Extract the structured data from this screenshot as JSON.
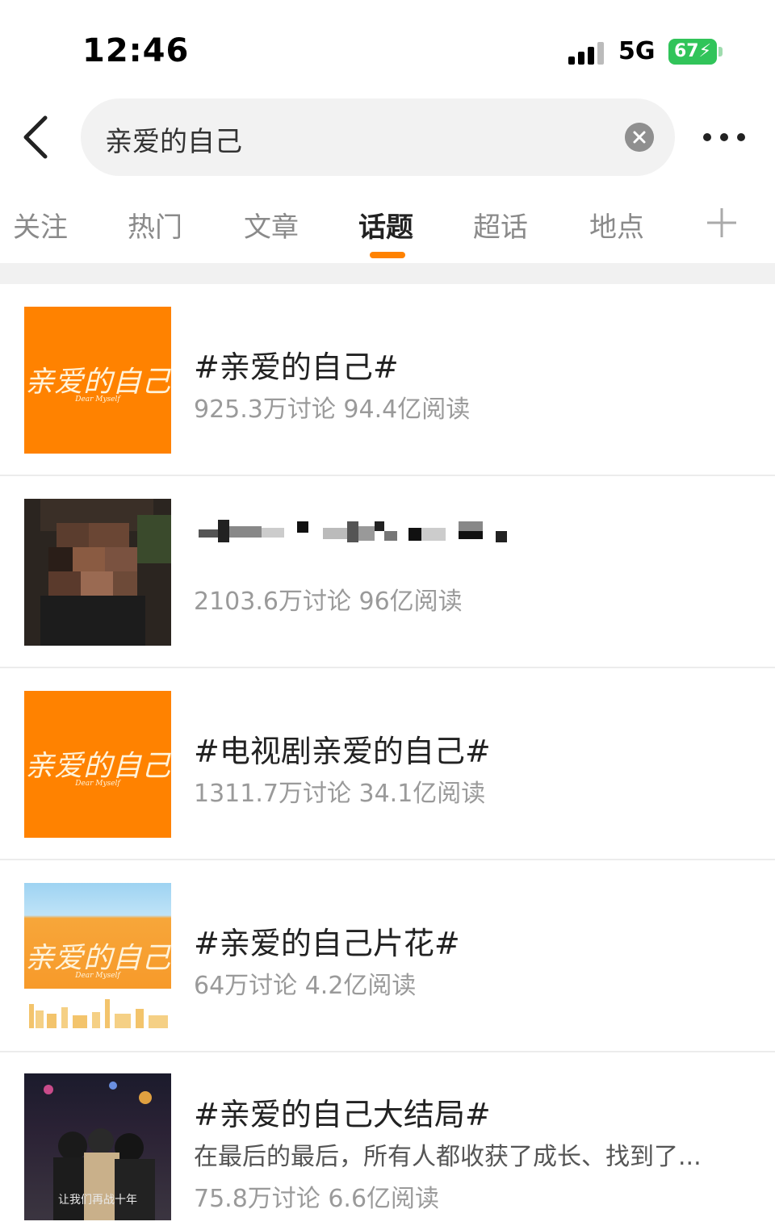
{
  "status": {
    "time": "12:46",
    "network": "5G",
    "battery": "67"
  },
  "search": {
    "query": "亲爱的自己"
  },
  "tabs": [
    {
      "label": "关注"
    },
    {
      "label": "热门"
    },
    {
      "label": "文章"
    },
    {
      "label": "话题",
      "active": true
    },
    {
      "label": "超话"
    },
    {
      "label": "地点"
    }
  ],
  "topics": [
    {
      "logo": "亲爱的自己",
      "logo_sub": "Dear Myself",
      "title": "#亲爱的自己#",
      "stats": "925.3万讨论 94.4亿阅读"
    },
    {
      "title": "",
      "stats": "2103.6万讨论 96亿阅读"
    },
    {
      "logo": "亲爱的自己",
      "logo_sub": "Dear Myself",
      "title": "#电视剧亲爱的自己#",
      "stats": "1311.7万讨论 34.1亿阅读"
    },
    {
      "logo": "亲爱的自己",
      "logo_sub": "Dear Myself",
      "title": "#亲爱的自己片花#",
      "stats": "64万讨论 4.2亿阅读"
    },
    {
      "caption": "让我们再战十年",
      "title": "#亲爱的自己大结局#",
      "desc": "在最后的最后，所有人都收获了成长、找到了...",
      "stats": "75.8万讨论 6.6亿阅读"
    }
  ],
  "colors": {
    "accent": "#ff8200",
    "battery": "#31c45a"
  },
  "icons": [
    "back-icon",
    "clear-icon",
    "more-icon",
    "plus-icon",
    "signal-icon"
  ]
}
